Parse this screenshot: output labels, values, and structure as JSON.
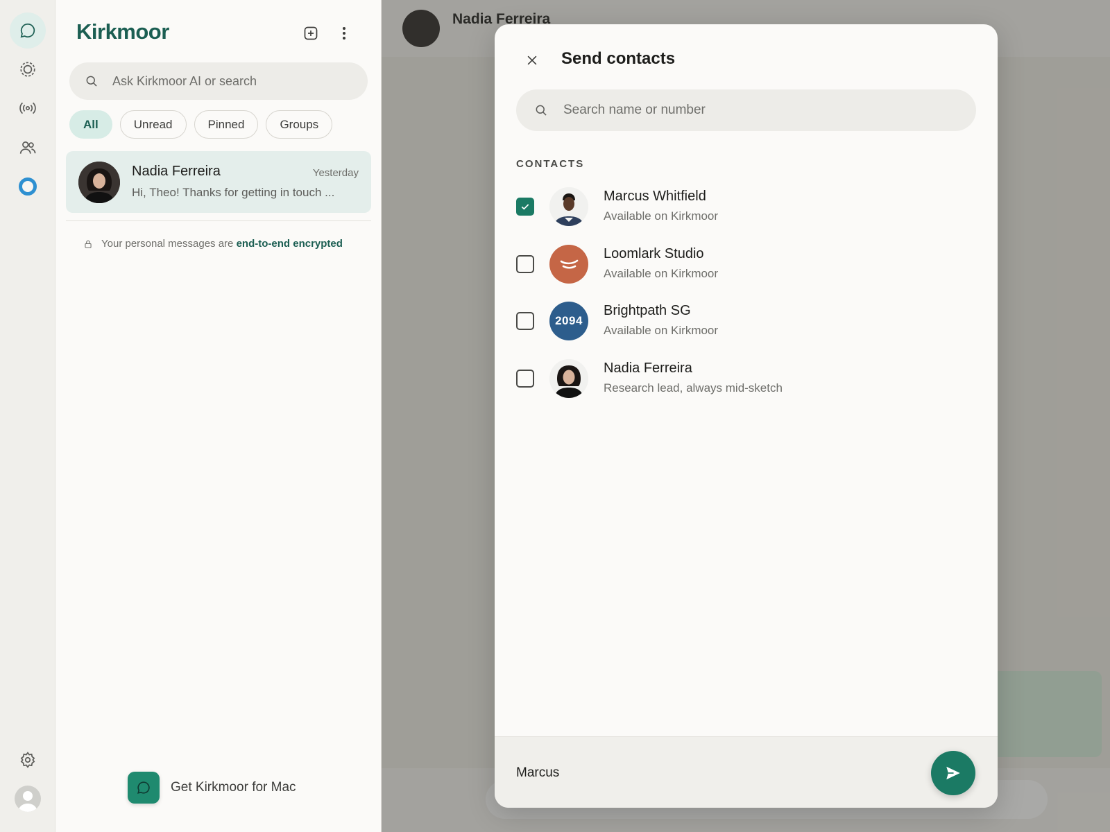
{
  "app": {
    "brand": "Kirkmoor",
    "colors": {
      "brand": "#1b5e52",
      "accent": "#1b7a64",
      "active_chip": "#d7ece6",
      "status_ring": "#2e90d1"
    }
  },
  "rail": {
    "icons": [
      "chat-icon",
      "status-icon",
      "channels-icon",
      "communities-icon",
      "ai-ring-icon",
      "settings-icon",
      "profile-icon"
    ]
  },
  "sidebar": {
    "search_placeholder": "Ask Kirkmoor AI or search",
    "filters": [
      "All",
      "Unread",
      "Pinned",
      "Groups"
    ],
    "active_filter": "All",
    "chats": [
      {
        "name": "Nadia Ferreira",
        "time": "Yesterday",
        "preview": "Hi, Theo! Thanks for getting in touch ..."
      }
    ],
    "encryption_text": "Your personal messages are",
    "encryption_link": "end-to-end encrypted",
    "get_app_label": "Get Kirkmoor for Mac"
  },
  "conversation": {
    "contact_name": "Nadia Ferreira"
  },
  "modal": {
    "title": "Send contacts",
    "search_placeholder": "Search name or number",
    "section_label": "CONTACTS",
    "contacts": [
      {
        "name": "Marcus Whitfield",
        "subtitle": "Available on Kirkmoor",
        "checked": true,
        "avatar": "photo"
      },
      {
        "name": "Loomlark Studio",
        "subtitle": "Available on Kirkmoor",
        "checked": false,
        "avatar": "logo"
      },
      {
        "name": "Brightpath SG",
        "subtitle": "Available on Kirkmoor",
        "checked": false,
        "avatar_text": "2094"
      },
      {
        "name": "Nadia Ferreira",
        "subtitle": "Research lead, always mid-sketch",
        "checked": false,
        "avatar": "photo"
      }
    ],
    "selected_summary": "Marcus"
  }
}
